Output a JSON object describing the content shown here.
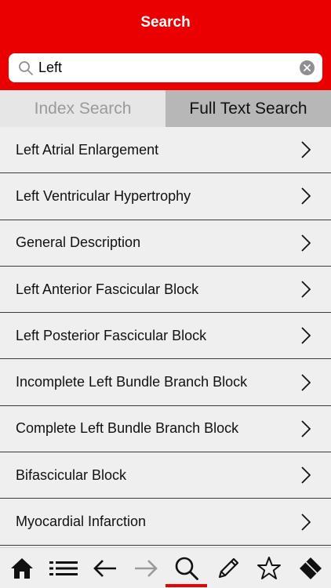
{
  "header": {
    "title": "Search"
  },
  "search": {
    "value": "Left",
    "placeholder": ""
  },
  "segments": {
    "index_label": "Index Search",
    "full_text_label": "Full Text Search",
    "selected": "Full Text Search"
  },
  "results": [
    {
      "label": "Left Atrial Enlargement"
    },
    {
      "label": "Left Ventricular Hypertrophy"
    },
    {
      "label": "General Description"
    },
    {
      "label": "Left Anterior Fascicular Block"
    },
    {
      "label": "Left Posterior Fascicular Block"
    },
    {
      "label": "Incomplete Left Bundle Branch Block"
    },
    {
      "label": "Complete Left Bundle Branch Block"
    },
    {
      "label": "Bifascicular Block"
    },
    {
      "label": "Myocardial Infarction"
    }
  ],
  "tabbar": {
    "items": [
      {
        "icon": "home-icon"
      },
      {
        "icon": "list-icon"
      },
      {
        "icon": "back-arrow-icon"
      },
      {
        "icon": "forward-arrow-icon"
      },
      {
        "icon": "search-icon"
      },
      {
        "icon": "pencil-icon"
      },
      {
        "icon": "star-icon"
      },
      {
        "icon": "eraser-icon"
      }
    ],
    "active": "search-icon"
  },
  "colors": {
    "brand": "#ea0000",
    "background": "#efefef",
    "segment_selected": "#b7b7b7"
  }
}
